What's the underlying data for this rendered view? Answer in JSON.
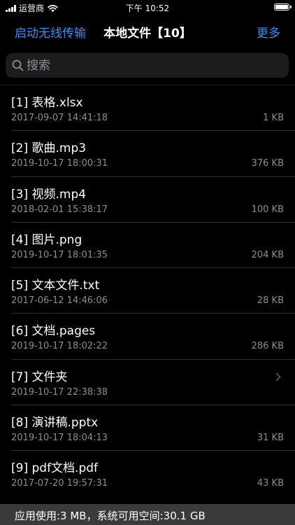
{
  "status_bar": {
    "carrier": "运营商",
    "time": "下午 10:52"
  },
  "nav": {
    "left_button": "启动无线传输",
    "title": "本地文件【10】",
    "right_button": "更多"
  },
  "search": {
    "placeholder": "搜索"
  },
  "files": [
    {
      "name": "[1] 表格.xlsx",
      "date": "2017-09-07 14:41:18",
      "size": "1 KB"
    },
    {
      "name": "[2] 歌曲.mp3",
      "date": "2019-10-17 18:00:31",
      "size": "376 KB"
    },
    {
      "name": "[3] 视频.mp4",
      "date": "2018-02-01 15:38:17",
      "size": "100 KB"
    },
    {
      "name": "[4] 图片.png",
      "date": "2019-10-17 18:01:35",
      "size": "204 KB"
    },
    {
      "name": "[5] 文本文件.txt",
      "date": "2017-06-12 14:46:06",
      "size": "28 KB"
    },
    {
      "name": "[6] 文档.pages",
      "date": "2019-10-17 18:02:22",
      "size": "286 KB"
    },
    {
      "name": "[7] 文件夹",
      "date": "2019-10-17 22:38:38",
      "size": ""
    },
    {
      "name": "[8] 演讲稿.pptx",
      "date": "2019-10-17 18:04:13",
      "size": "31 KB"
    },
    {
      "name": "[9] pdf文档.pdf",
      "date": "2017-07-20 19:57:31",
      "size": "43 KB"
    }
  ],
  "footer": {
    "storage_text": "应用使用:3 MB，系统可用空间:30.1 GB"
  },
  "colors": {
    "accent": "#3b8cf0",
    "secondary_text": "#8e8e93"
  }
}
